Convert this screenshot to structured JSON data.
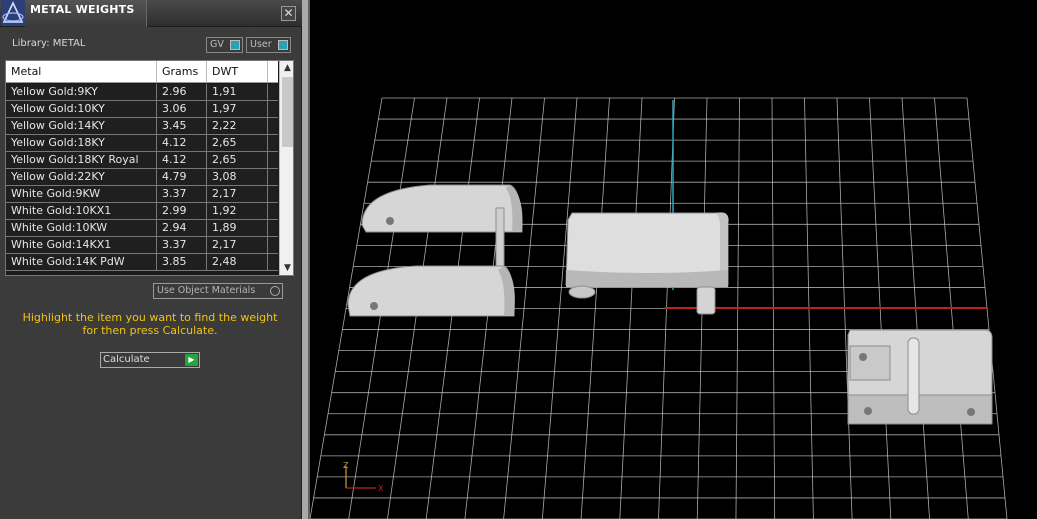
{
  "panel": {
    "title": "METAL WEIGHTS",
    "close_glyph": "✕",
    "library_label": "Library: METAL",
    "gv_label": "GV",
    "user_label": "User",
    "columns": [
      "Metal",
      "Grams",
      "DWT"
    ],
    "rows": [
      {
        "metal": "Yellow Gold:9KY",
        "grams": "2.96",
        "dwt": "1,91"
      },
      {
        "metal": "Yellow Gold:10KY",
        "grams": "3.06",
        "dwt": "1,97"
      },
      {
        "metal": "Yellow Gold:14KY",
        "grams": "3.45",
        "dwt": "2,22"
      },
      {
        "metal": "Yellow Gold:18KY",
        "grams": "4.12",
        "dwt": "2,65"
      },
      {
        "metal": "Yellow Gold:18KY Royal",
        "grams": "4.12",
        "dwt": "2,65"
      },
      {
        "metal": "Yellow Gold:22KY",
        "grams": "4.79",
        "dwt": "3,08"
      },
      {
        "metal": "White Gold:9KW",
        "grams": "3.37",
        "dwt": "2,17"
      },
      {
        "metal": "White Gold:10KX1",
        "grams": "2.99",
        "dwt": "1,92"
      },
      {
        "metal": "White Gold:10KW",
        "grams": "2.94",
        "dwt": "1,89"
      },
      {
        "metal": "White Gold:14KX1",
        "grams": "3.37",
        "dwt": "2,17"
      },
      {
        "metal": "White Gold:14K PdW",
        "grams": "3.85",
        "dwt": "2,48"
      }
    ],
    "scroll_up_glyph": "▲",
    "scroll_down_glyph": "▼",
    "use_object_materials_label": "Use Object Materials",
    "instruction_line1": "Highlight the item you want to find the weight",
    "instruction_line2": "for then press Calculate.",
    "calculate_label": "Calculate",
    "calculate_go_glyph": "▶"
  },
  "viewport": {
    "axis_x_label": "X",
    "axis_z_label": "Z",
    "colors": {
      "grid": "#c8c8c8",
      "axis_red": "#c0201a",
      "axis_cyan": "#2aa6b8",
      "object_fill": "#d9d9d9",
      "object_shade": "#a9a9a9",
      "instruction": "#f2c311"
    },
    "icons": [
      "app-logo-icon",
      "close-icon",
      "scroll-up-icon",
      "scroll-down-icon",
      "play-icon",
      "axis-triad-icon"
    ]
  }
}
